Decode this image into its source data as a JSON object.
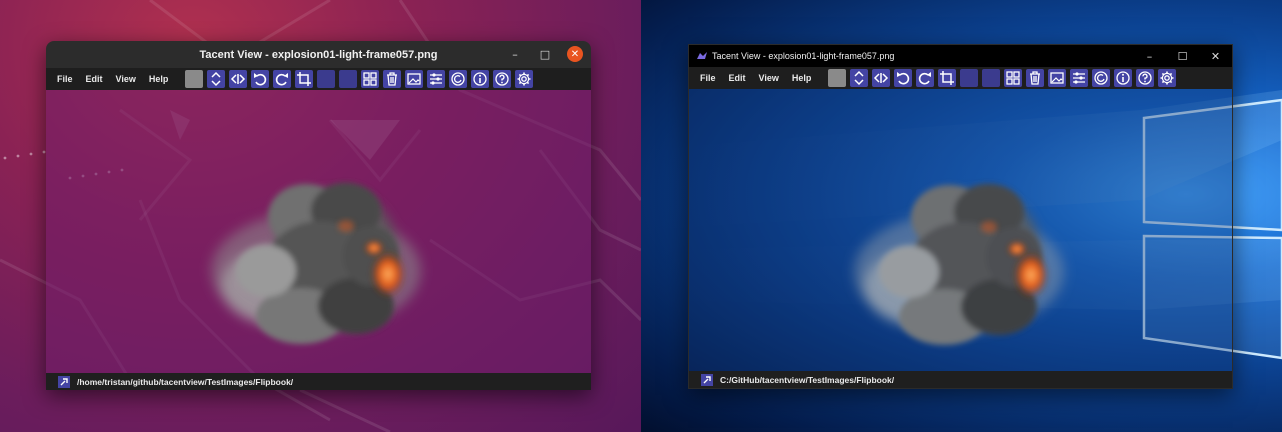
{
  "ubuntu_window": {
    "title": "Tacent View - explosion01-light-frame057.png",
    "menu": [
      "File",
      "Edit",
      "View",
      "Help"
    ],
    "status_path": "/home/tristan/github/tacentview/TestImages/Flipbook/",
    "controls": {
      "minimize": "–",
      "maximize": "□",
      "close": "✕"
    }
  },
  "windows_window": {
    "title": "Tacent View - explosion01-light-frame057.png",
    "menu": [
      "File",
      "Edit",
      "View",
      "Help"
    ],
    "status_path": "C:/GitHub/tacentview/TestImages/Flipbook/",
    "controls": {
      "minimize": "–",
      "maximize": "☐",
      "close": "✕"
    }
  },
  "toolbar_icons": [
    "color-swatch-icon",
    "flip-vertical-icon",
    "flip-horizontal-icon",
    "rotate-left-icon",
    "rotate-right-icon",
    "crop-icon",
    "channel-icon",
    "alpha-icon",
    "contact-sheet-icon",
    "delete-icon",
    "edit-image-icon",
    "preferences-icon",
    "refresh-icon",
    "info-icon",
    "help-icon",
    "settings-icon"
  ],
  "colors": {
    "ubuntu_accent": "#e95420",
    "toolbar_button": "#4444a4",
    "titlebar_dark": "#2c2c2c",
    "menubar": "#1e1e1e"
  }
}
